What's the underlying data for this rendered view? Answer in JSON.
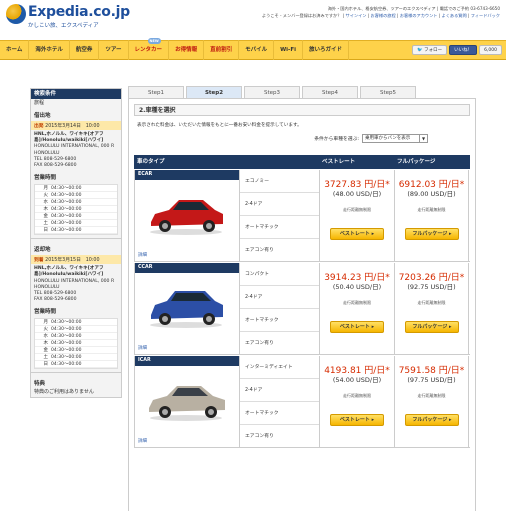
{
  "brand": {
    "name": "Expedia.co.jp",
    "tagline": "かしこい旅、エクスペディア"
  },
  "toplinks": {
    "line1": "海外・国内ホテル、格安航空券、ツアーのエクスペディア | 電話でのご予約 03-6743-6650",
    "welcome": "ようこそ - メンバー登録はお済みですか？",
    "links": [
      "サインイン",
      "お客様の旅程",
      "お客様のアカウント",
      "よくある質問",
      "フィードバック"
    ]
  },
  "nav": {
    "items": [
      "ホーム",
      "海外ホテル",
      "航空券",
      "ツアー",
      "レンタカー",
      "お得情報",
      "直前割引",
      "モバイル",
      "Wi-Fi",
      "旅いろガイド"
    ],
    "badge": "NEW",
    "follow": "フォロー",
    "like": "いいね！",
    "like_count": "6,000"
  },
  "steps": [
    "Step1",
    "Step2",
    "Step3",
    "Step4",
    "Step5"
  ],
  "sidebar": {
    "title": "検索条件",
    "route": "旅程",
    "pickup": {
      "title": "借出地",
      "date_label": "出発",
      "date": "2015年3月14日　10:00",
      "location": "HNL,ホノルル、ワイキキ[オアフ島]/Honolulu/waikiki[ハワイ]",
      "address": "HONOLULU INTERNATIONAL, 000 R HONOLULU",
      "tel": "TEL 808-529-6800",
      "fax": "FAX 808-529-6800",
      "hours_title": "営業時間",
      "hours": [
        {
          "d": "月",
          "h": "04:30～00:00"
        },
        {
          "d": "火",
          "h": "04:30～00:00"
        },
        {
          "d": "水",
          "h": "04:30～00:00"
        },
        {
          "d": "木",
          "h": "04:30～00:00"
        },
        {
          "d": "金",
          "h": "04:30～00:00"
        },
        {
          "d": "土",
          "h": "04:30～00:00"
        },
        {
          "d": "日",
          "h": "04:30～00:00"
        }
      ]
    },
    "dropoff": {
      "title": "返却地",
      "date_label": "到着",
      "date": "2015年3月15日　10:00",
      "location": "HNL,ホノルル、ワイキキ[オアフ島]/Honolulu/waikiki[ハワイ]",
      "address": "HONOLULU INTERNATIONAL, 000 R HONOLULU",
      "tel": "TEL 808-529-6800",
      "fax": "FAX 808-529-6800",
      "hours_title": "営業時間",
      "hours": [
        {
          "d": "月",
          "h": "04:30～00:00"
        },
        {
          "d": "火",
          "h": "04:30～00:00"
        },
        {
          "d": "水",
          "h": "04:30～00:00"
        },
        {
          "d": "木",
          "h": "04:30～00:00"
        },
        {
          "d": "金",
          "h": "04:30～00:00"
        },
        {
          "d": "土",
          "h": "04:30～00:00"
        },
        {
          "d": "日",
          "h": "04:30～00:00"
        }
      ]
    },
    "special_title": "特典",
    "special_text": "特典のご利用はありません"
  },
  "main": {
    "title": "2.車種を選択",
    "note": "表示された料金は、いただいた情報をもとに一番お安い料金を提示しています。",
    "filter_label": "条件から車種を選ぶ:",
    "filter_value": "乗用車からバンを表示",
    "headers": [
      "車のタイプ",
      "ベストレート",
      "フルパッケージ"
    ],
    "detail_label": "詳細",
    "unlimited": "走行距離無制限",
    "best_btn": "ベストレート",
    "full_btn": "フルパッケージ",
    "cars": [
      {
        "code": "ECAR",
        "class": "エコノミー",
        "doors": "2-4ドア",
        "trans": "オートマチック",
        "ac": "エアコン有り",
        "best": "3727.83 円/日*",
        "best_usd": "(48.00 USD/日)",
        "full": "6912.03 円/日*",
        "full_usd": "(89.00 USD/日)",
        "color": "#c41818"
      },
      {
        "code": "CCAR",
        "class": "コンパクト",
        "doors": "2-4ドア",
        "trans": "オートマチック",
        "ac": "エアコン有り",
        "best": "3914.23 円/日*",
        "best_usd": "(50.40 USD/日)",
        "full": "7203.26 円/日*",
        "full_usd": "(92.75 USD/日)",
        "color": "#2c4fa6"
      },
      {
        "code": "ICAR",
        "class": "インターミディエイト",
        "doors": "2-4ドア",
        "trans": "オートマチック",
        "ac": "エアコン有り",
        "best": "4193.81 円/日*",
        "best_usd": "(54.00 USD/日)",
        "full": "7591.58 円/日*",
        "full_usd": "(97.75 USD/日)",
        "color": "#b8b0a2"
      }
    ]
  }
}
